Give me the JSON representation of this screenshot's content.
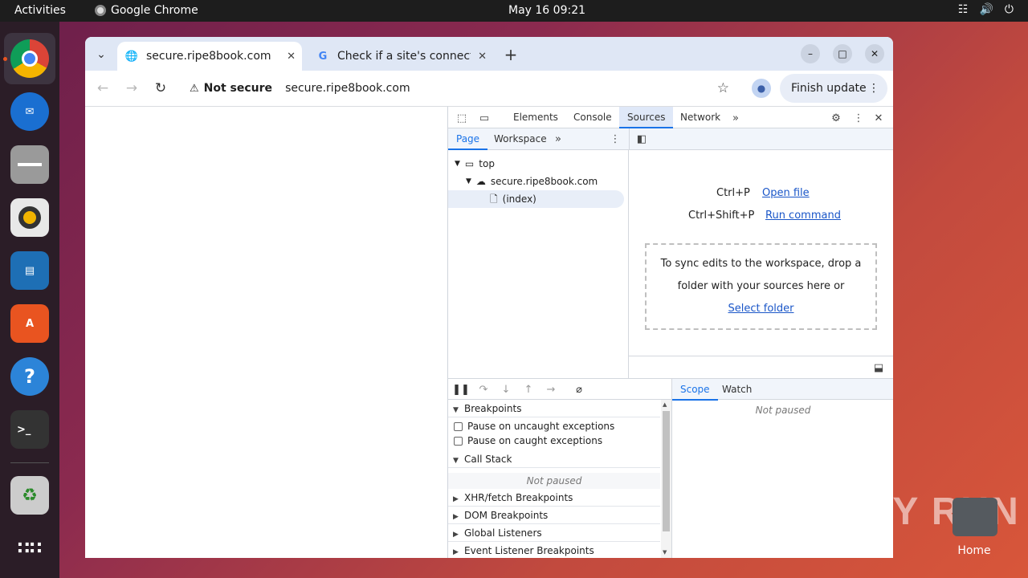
{
  "topbar": {
    "activities": "Activities",
    "app_name": "Google Chrome",
    "clock": "May 16  09:21"
  },
  "dock": {
    "items": [
      "chrome-icon",
      "thunderbird-icon",
      "files-icon",
      "rhythmbox-icon",
      "writer-icon",
      "app-center-icon",
      "help-icon",
      "terminal-icon",
      "trash-icon",
      "app-grid-icon"
    ]
  },
  "desktop": {
    "home_label": "Home",
    "watermark": "ANY RUN"
  },
  "browser": {
    "tabs": [
      {
        "title": "secure.ripe8book.com",
        "active": true
      },
      {
        "title": "Check if a site's connecti",
        "active": false
      }
    ],
    "security_label": "Not secure",
    "url": "secure.ripe8book.com",
    "finish_update": "Finish update"
  },
  "devtools": {
    "tabs": [
      "Elements",
      "Console",
      "Sources",
      "Network"
    ],
    "active_tab": "Sources",
    "nav_tabs": [
      "Page",
      "Workspace"
    ],
    "tree": {
      "top": "top",
      "domain": "secure.ripe8book.com",
      "file": "(index)"
    },
    "shortcuts": [
      {
        "keys": "Ctrl+P",
        "action": "Open file"
      },
      {
        "keys": "Ctrl+Shift+P",
        "action": "Run command"
      }
    ],
    "dropzone": {
      "text_line1": "To sync edits to the workspace, drop a",
      "text_line2": "folder with your sources here or",
      "link": "Select folder"
    },
    "scope_tabs": [
      "Scope",
      "Watch"
    ],
    "not_paused": "Not paused",
    "sections": {
      "breakpoints": "Breakpoints",
      "pause_uncaught": "Pause on uncaught exceptions",
      "pause_caught": "Pause on caught exceptions",
      "call_stack": "Call Stack",
      "xhr": "XHR/fetch Breakpoints",
      "dom": "DOM Breakpoints",
      "global": "Global Listeners",
      "event": "Event Listener Breakpoints"
    }
  }
}
